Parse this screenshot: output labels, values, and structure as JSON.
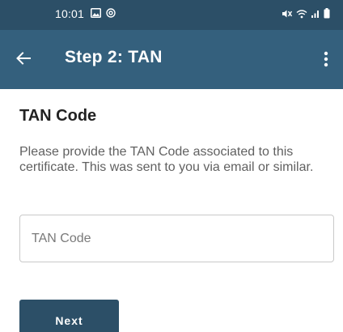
{
  "status_bar": {
    "time": "10:01",
    "icons": [
      "image-icon",
      "at-sign-icon",
      "mute-icon",
      "wifi-icon",
      "signal-icon",
      "battery-icon"
    ]
  },
  "app_bar": {
    "title": "Step 2: TAN",
    "back_icon": "arrow-left-icon",
    "menu_icon": "more-vertical-icon"
  },
  "main": {
    "section_title": "TAN Code",
    "description": "Please provide the TAN Code associated to this certificate. This was sent to you via email or similar.",
    "tan_input": {
      "value": "",
      "placeholder": "TAN Code"
    },
    "next_label": "Next"
  },
  "colors": {
    "status_bar": "#2c4f67",
    "app_bar": "#34607d",
    "button": "#2c4f67"
  }
}
